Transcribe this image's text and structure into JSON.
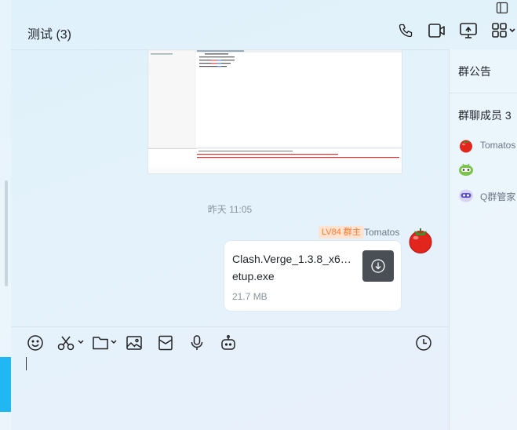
{
  "header": {
    "title": "测试 (3)"
  },
  "right_panel": {
    "announcement": "群公告",
    "members_title": "群聊成员 3",
    "members": [
      {
        "name": "Tomatos",
        "avatar": "tomato-avatar"
      },
      {
        "name": "",
        "avatar": "green-robot-avatar"
      },
      {
        "name": "Q群管家",
        "avatar": "purple-robot-avatar"
      }
    ]
  },
  "messages": {
    "timestamp": "昨天 11:05",
    "sender": {
      "badge": "LV84 群主",
      "name": "Tomatos"
    },
    "file": {
      "name": "Clash.Verge_1.3.8_x6…etup.exe",
      "size": "21.7 MB"
    }
  },
  "colors": {
    "accent": "#21b7f2",
    "badge_text": "#ff7a2e",
    "badge_bg": "#ffe2cf"
  }
}
